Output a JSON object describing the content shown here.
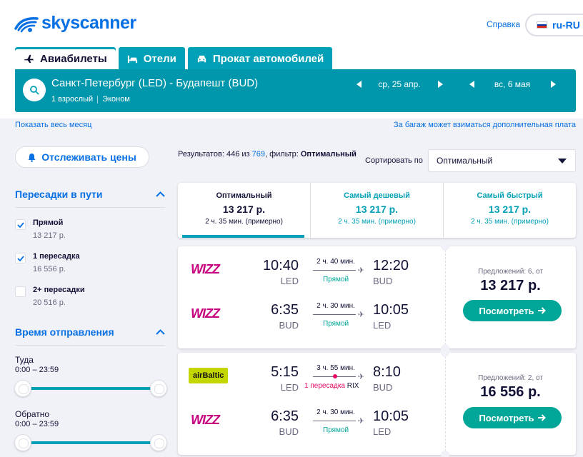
{
  "header": {
    "logo_text": "skyscanner",
    "help_label": "Справка",
    "locale_label": "ru-RU"
  },
  "tabs": [
    {
      "label": "Авиабилеты"
    },
    {
      "label": "Отели"
    },
    {
      "label": "Прокат автомобилей"
    }
  ],
  "search": {
    "route": "Санкт-Петербург (LED) - Будапешт (BUD)",
    "passengers": "1 взрослый",
    "cabin": "Эконом",
    "depart_date": "ср, 25 апр.",
    "return_date": "вс, 6 мая"
  },
  "links": {
    "show_month": "Показать весь месяц",
    "baggage": "За багаж может взиматься дополнительная плата"
  },
  "sidebar": {
    "track_label": "Отслеживать цены",
    "stops_title": "Пересадки в пути",
    "stop_options": [
      {
        "label": "Прямой",
        "price": "13 217 р.",
        "checked": true
      },
      {
        "label": "1 пересадка",
        "price": "16 556 р.",
        "checked": true
      },
      {
        "label": "2+ пересадки",
        "price": "20 516 р.",
        "checked": false
      }
    ],
    "departure_title": "Время отправления",
    "outbound_label": "Туда",
    "outbound_range": "0:00 – 23:59",
    "return_label": "Обратно",
    "return_range": "0:00 – 23:59"
  },
  "results": {
    "count_prefix": "Результатов: 446 из ",
    "total": "769",
    "filter_prefix": ", фильтр: ",
    "filter_value": "Оптимальный",
    "sort_label": "Сортировать по",
    "sort_value": "Оптимальный"
  },
  "sort_tabs": [
    {
      "title": "Оптимальный",
      "price": "13 217 р.",
      "duration": "2 ч. 35 мин. (примерно)"
    },
    {
      "title": "Самый дешевый",
      "price": "13 217 р.",
      "duration": "2 ч. 35 мин. (примерно)"
    },
    {
      "title": "Самый быстрый",
      "price": "13 217 р.",
      "duration": "2 ч. 35 мин. (примерно)"
    }
  ],
  "cards": [
    {
      "legs": [
        {
          "airline": "WIZZ",
          "dep_time": "10:40",
          "dep_ap": "LED",
          "duration": "2 ч. 40 мин.",
          "stops": "Прямой",
          "arr_time": "12:20",
          "arr_ap": "BUD"
        },
        {
          "airline": "WIZZ",
          "dep_time": "6:35",
          "dep_ap": "BUD",
          "duration": "2 ч. 30 мин.",
          "stops": "Прямой",
          "arr_time": "10:05",
          "arr_ap": "LED"
        }
      ],
      "offers": "Предложений: 6, от",
      "price": "13 217 р.",
      "button": "Посмотреть"
    },
    {
      "legs": [
        {
          "airline": "airBaltic",
          "dep_time": "5:15",
          "dep_ap": "LED",
          "duration": "3 ч. 55 мин.",
          "stops": "1 пересадка",
          "via": "RIX",
          "arr_time": "8:10",
          "arr_ap": "BUD"
        },
        {
          "airline": "WIZZ",
          "dep_time": "6:35",
          "dep_ap": "BUD",
          "duration": "2 ч. 30 мин.",
          "stops": "Прямой",
          "arr_time": "10:05",
          "arr_ap": "LED"
        }
      ],
      "offers": "Предложений: 2, от",
      "price": "16 556 р.",
      "button": "Посмотреть"
    }
  ]
}
